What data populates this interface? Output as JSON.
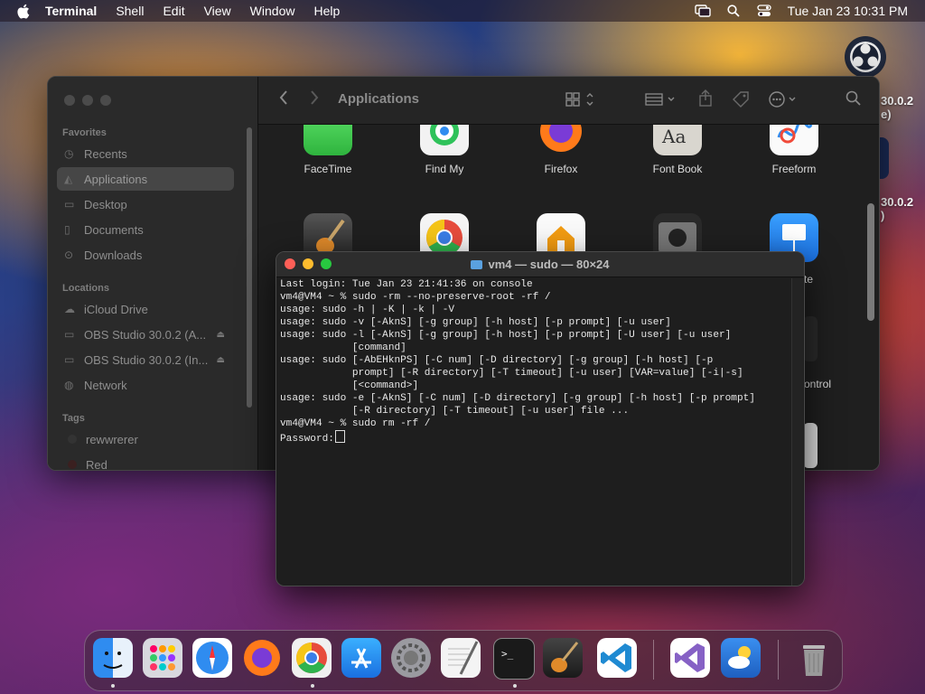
{
  "menubar": {
    "app_name": "Terminal",
    "items": [
      "Shell",
      "Edit",
      "View",
      "Window",
      "Help"
    ],
    "clock": "Tue Jan 23  10:31 PM",
    "status_icons": [
      "screen-mirroring-icon",
      "search-icon",
      "control-center-icon"
    ]
  },
  "desktop": {
    "icons": [
      {
        "name": "obs-icon",
        "label1": "30.0.2",
        "label2": "e)"
      },
      {
        "name": "obs-icon",
        "label1": "30.0.2",
        "label2": ")"
      }
    ]
  },
  "finder": {
    "title": "Applications",
    "sidebar": {
      "favorites_header": "Favorites",
      "favorites": [
        "Recents",
        "Applications",
        "Desktop",
        "Documents",
        "Downloads"
      ],
      "locations_header": "Locations",
      "locations": [
        "iCloud Drive",
        "OBS Studio 30.0.2 (A...",
        "OBS Studio 30.0.2 (In...",
        "Network"
      ],
      "tags_header": "Tags",
      "tags": [
        "rewwrerer",
        "Red"
      ]
    },
    "apps_row1": [
      "FaceTime",
      "Find My",
      "Firefox",
      "Font Book",
      "Freeform"
    ],
    "partial_labels": [
      "te",
      "ontrol"
    ]
  },
  "terminal": {
    "title": "vm4 — sudo — 80×24",
    "lines": [
      "Last login: Tue Jan 23 21:41:36 on console",
      "vm4@VM4 ~ % sudo -rm --no-preserve-root -rf /",
      "usage: sudo -h | -K | -k | -V",
      "usage: sudo -v [-AknS] [-g group] [-h host] [-p prompt] [-u user]",
      "usage: sudo -l [-AknS] [-g group] [-h host] [-p prompt] [-U user] [-u user]",
      "            [command]",
      "usage: sudo [-AbEHknPS] [-C num] [-D directory] [-g group] [-h host] [-p",
      "            prompt] [-R directory] [-T timeout] [-u user] [VAR=value] [-i|-s]",
      "            [<command>]",
      "usage: sudo -e [-AknS] [-C num] [-D directory] [-g group] [-h host] [-p prompt]",
      "            [-R directory] [-T timeout] [-u user] file ...",
      "vm4@VM4 ~ % sudo rm -rf /",
      "Password:"
    ]
  },
  "dock": {
    "apps": [
      "finder-icon",
      "launchpad-icon",
      "safari-icon",
      "firefox-icon",
      "chrome-icon",
      "app-store-icon",
      "system-settings-icon",
      "textedit-icon",
      "terminal-icon",
      "garageband-icon",
      "vscode-icon",
      "visual-studio-icon",
      "weather-icon",
      "trash-icon"
    ]
  }
}
